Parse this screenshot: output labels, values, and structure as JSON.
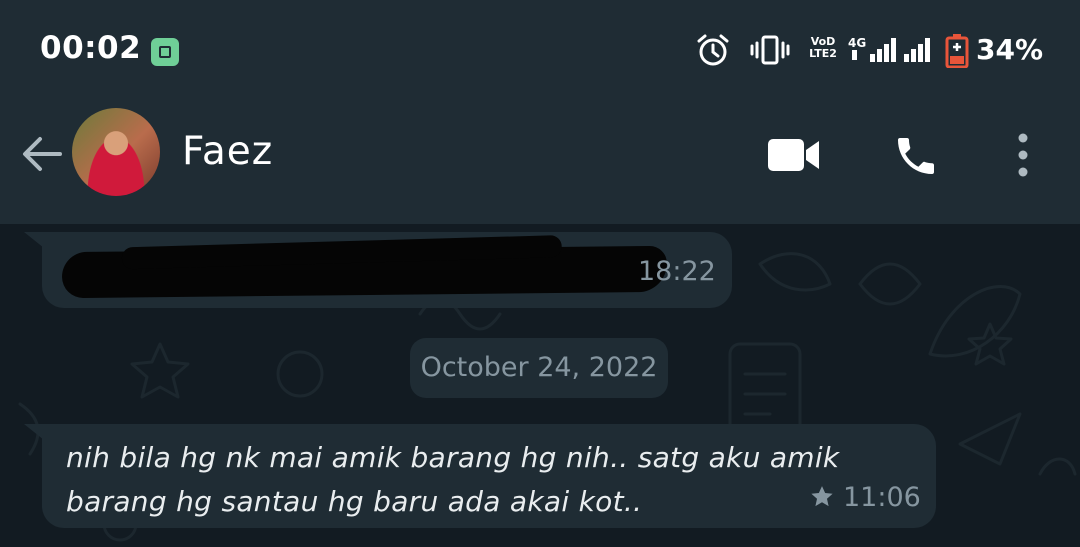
{
  "status_bar": {
    "time": "00:02",
    "volte_line1": "VoD",
    "volte_line2": "LTE2",
    "network": "4G",
    "battery_percent": "34%",
    "battery_level": 0.34,
    "icons": [
      "app-badge-icon",
      "alarm-icon",
      "vibrate-icon",
      "volte-icon",
      "signal-icon",
      "battery-icon"
    ]
  },
  "header": {
    "contact_name": "Faez",
    "icons": [
      "back-arrow-icon",
      "video-call-icon",
      "voice-call-icon",
      "more-options-icon"
    ]
  },
  "messages": [
    {
      "direction": "incoming",
      "text": "",
      "redacted": true,
      "time": "18:22"
    },
    {
      "direction": "incoming",
      "text": "nih bila hg nk mai amik barang hg nih.. satg aku amik barang hg santau hg baru ada akai kot..",
      "time": "11:06",
      "starred": true
    }
  ],
  "date_separator": "October 24, 2022",
  "colors": {
    "header_bg": "#1f2c34",
    "chat_bg": "#121b22",
    "bubble_bg": "#1f2c34",
    "text": "#e9edef",
    "meta_text": "#8696a0",
    "battery_accent": "#e8553a"
  }
}
